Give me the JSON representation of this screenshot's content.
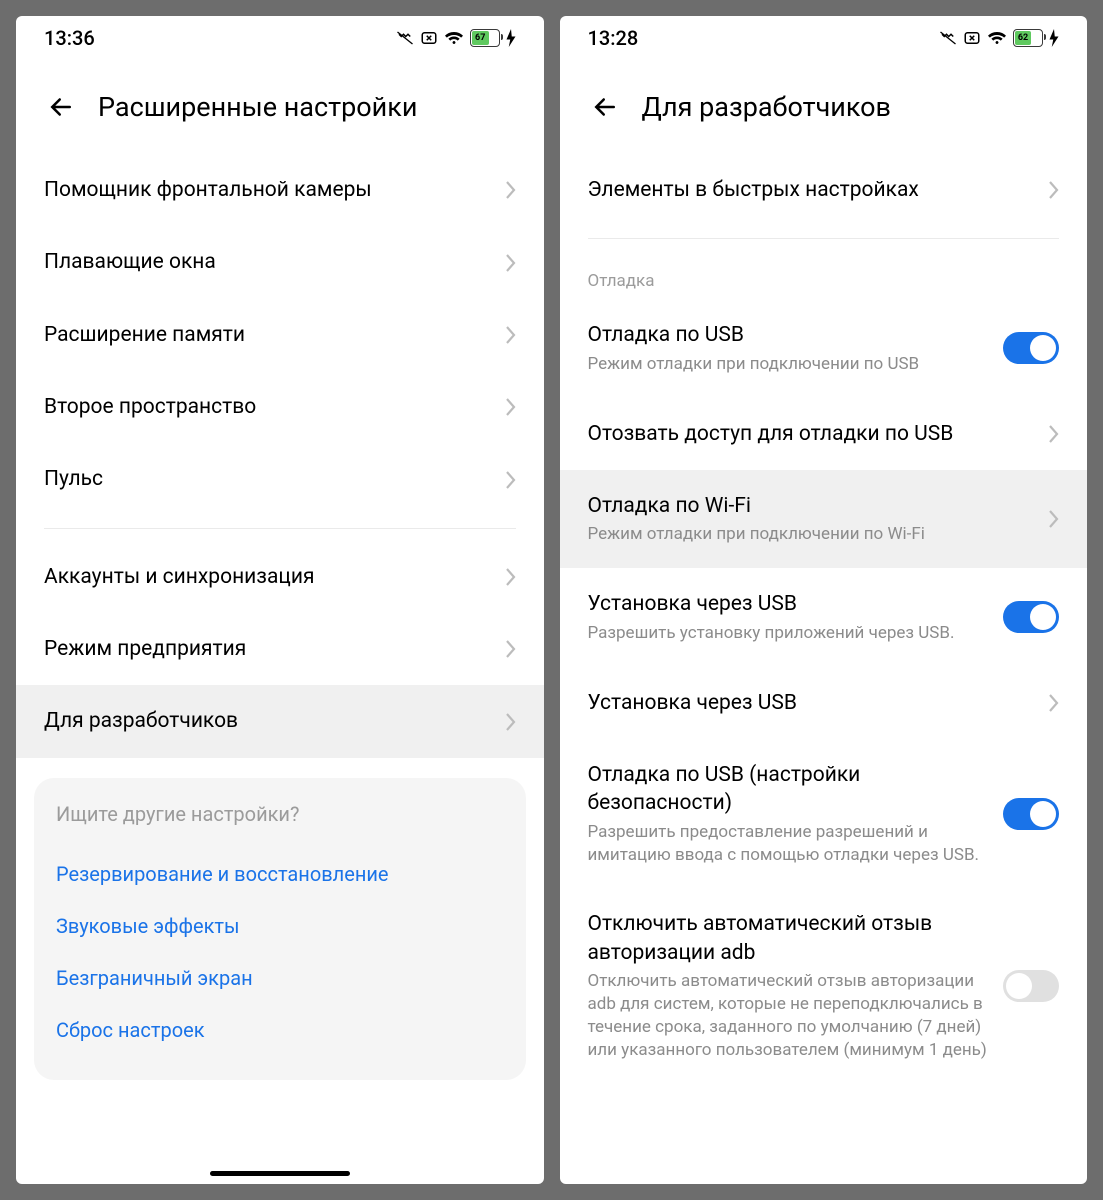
{
  "left": {
    "status": {
      "time": "13:36",
      "battery": "67"
    },
    "title": "Расширенные настройки",
    "items": [
      {
        "label": "Помощник фронтальной камеры"
      },
      {
        "label": "Плавающие окна"
      },
      {
        "label": "Расширение памяти"
      },
      {
        "label": "Второе пространство"
      },
      {
        "label": "Пульс"
      }
    ],
    "items2": [
      {
        "label": "Аккаунты и синхронизация"
      },
      {
        "label": "Режим предприятия"
      },
      {
        "label": "Для разработчиков",
        "highlighted": true
      }
    ],
    "search": {
      "prompt": "Ищите другие настройки?",
      "links": [
        "Резервирование и восстановление",
        "Звуковые эффекты",
        "Безграничный экран",
        "Сброс настроек"
      ]
    }
  },
  "right": {
    "status": {
      "time": "13:28",
      "battery": "62"
    },
    "title": "Для разработчиков",
    "topItem": {
      "label": "Элементы в быстрых настройках"
    },
    "section": "Отладка",
    "items": [
      {
        "title": "Отладка по USB",
        "sub": "Режим отладки при подключении по USB",
        "toggle": "on"
      },
      {
        "title": "Отозвать доступ для отладки по USB",
        "chev": true
      },
      {
        "title": "Отладка по Wi-Fi",
        "sub": "Режим отладки при подключении по Wi-Fi",
        "chev": true,
        "highlighted": true
      },
      {
        "title": "Установка через USB",
        "sub": "Разрешить установку приложений через USB.",
        "toggle": "on"
      },
      {
        "title": "Установка через USB",
        "chev": true
      },
      {
        "title": "Отладка по USB (настройки безопасности)",
        "sub": "Разрешить предоставление разрешений и имитацию ввода с помощью отладки через USB.",
        "toggle": "on"
      },
      {
        "title": "Отключить автоматический отзыв авторизации adb",
        "sub": "Отключить автоматический отзыв авторизации adb для систем, которые не переподключались в течение срока, заданного по умолчанию (7 дней) или указанного пользователем (минимум 1 день)",
        "toggle": "off"
      }
    ]
  }
}
